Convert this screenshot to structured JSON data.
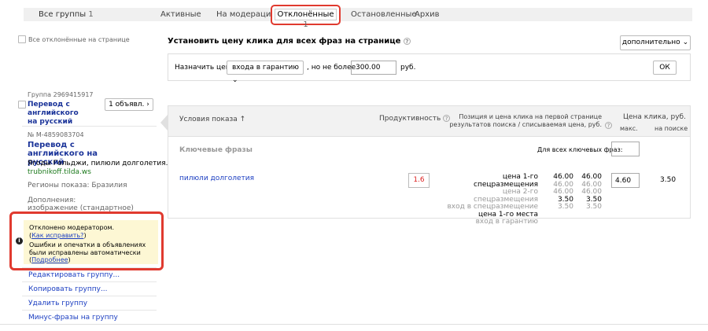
{
  "tabs": {
    "all_label": "Все группы",
    "all_count": "1",
    "active": "Активные",
    "moderation": "На модерации",
    "rejected": "Отклонённые",
    "rejected_count": "1",
    "stopped": "Остановленные",
    "archive": "Архив"
  },
  "select_all": "Все отклонённые на странице",
  "price_block": {
    "title": "Установить цену клика для всех фраз на странице",
    "extra_button": "дополнительно",
    "assign_label": "Назначить цену",
    "mode_value": "входа в гарантию",
    "max_label": ", но не более",
    "max_value": "300.00",
    "currency": "руб.",
    "ok_button": "ОК"
  },
  "group": {
    "id_label": "Группа 2969415917",
    "name": "Перевод с английского на русский",
    "ads_button": "1 объявл.",
    "ad_id": "№ М-4859083704",
    "ad_title": "Перевод с английского на русский",
    "ad_text": "Ягоды Гольджи, пилюли долголетия.",
    "ad_domain": "trubnikoff.tilda.ws",
    "regions": "Регионы показа: Бразилия",
    "extras_label": "Дополнения:",
    "extras_value": "изображение (стандартное)"
  },
  "warning": {
    "rejected_text": "Отклонено модератором.",
    "fix_link": "Как исправить?",
    "auto_fix_text": "Ошибки и опечатки в объявлениях были исправлены автоматически",
    "more_link": "Подробнее"
  },
  "actions": {
    "edit": "Редактировать группу...",
    "copy": "Копировать группу...",
    "delete": "Удалить группу",
    "minus": "Минус-фразы на группу"
  },
  "table": {
    "col_conditions": "Условия показа",
    "col_productivity": "Продуктивность",
    "col_position": "Позиция и цена клика на первой странице результатов поиска / списываемая цена, руб.",
    "col_price": "Цена клика, руб.",
    "col_max": "макс.",
    "col_on_search": "на поиске",
    "section_keywords": "Ключевые фразы",
    "all_keywords_label": "Для всех ключевых фраз:",
    "rows": [
      {
        "phrase": "пилюли долголетия",
        "productivity": "1.6",
        "positions": [
          {
            "label": "цена 1-го спецразмещения",
            "a": "46.00",
            "b": "46.00",
            "dim": false
          },
          {
            "label": "цена 2-го спецразмещения",
            "a": "46.00",
            "b": "46.00",
            "dim": true
          },
          {
            "label": "вход в спецразмещение",
            "a": "46.00",
            "b": "46.00",
            "dim": true
          },
          {
            "label": "цена 1-го места",
            "a": "3.50",
            "b": "3.50",
            "dim": false
          },
          {
            "label": "вход в гарантию",
            "a": "3.50",
            "b": "3.50",
            "dim": true
          }
        ],
        "max_price": "4.60",
        "search_price": "3.50"
      }
    ]
  }
}
